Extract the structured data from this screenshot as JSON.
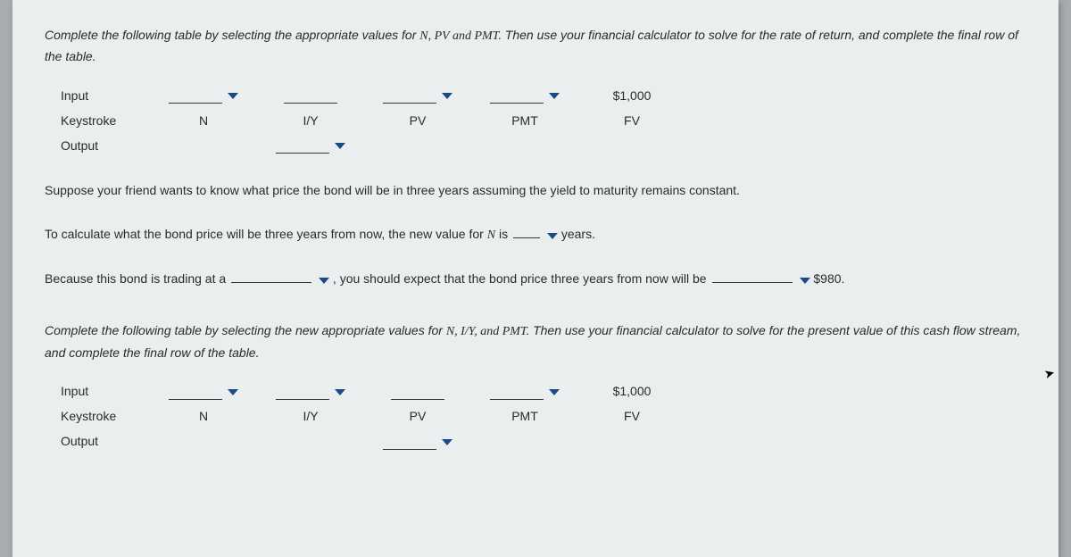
{
  "instruction1_a": "Complete the following table by selecting the appropriate values for ",
  "instruction1_vars": "N, PV and PMT.",
  "instruction1_b": " Then use your financial calculator to solve for the rate of return, and complete the final row of the table.",
  "row_labels": {
    "input": "Input",
    "keystroke": "Keystroke",
    "output": "Output"
  },
  "keystrokes": {
    "n": "N",
    "iy": "I/Y",
    "pv": "PV",
    "pmt": "PMT",
    "fv": "FV"
  },
  "fv_value": "$1,000",
  "para1": "Suppose your friend wants to know what price the bond will be in three years assuming the yield to maturity remains constant.",
  "para2_a": "To calculate what the bond price will be three years from now, the new value for ",
  "para2_var": "N",
  "para2_b": " is ",
  "para2_c": " years.",
  "para3_a": "Because this bond is trading at a ",
  "para3_b": " , you should expect that the bond price three years from now will be ",
  "para3_c": " $980.",
  "instruction2_a": "Complete the following table by selecting the new appropriate values for ",
  "instruction2_vars": "N, I/Y, and PMT.",
  "instruction2_b": " Then use your financial calculator to solve for the present value of this cash flow stream, and complete the final row of the table."
}
